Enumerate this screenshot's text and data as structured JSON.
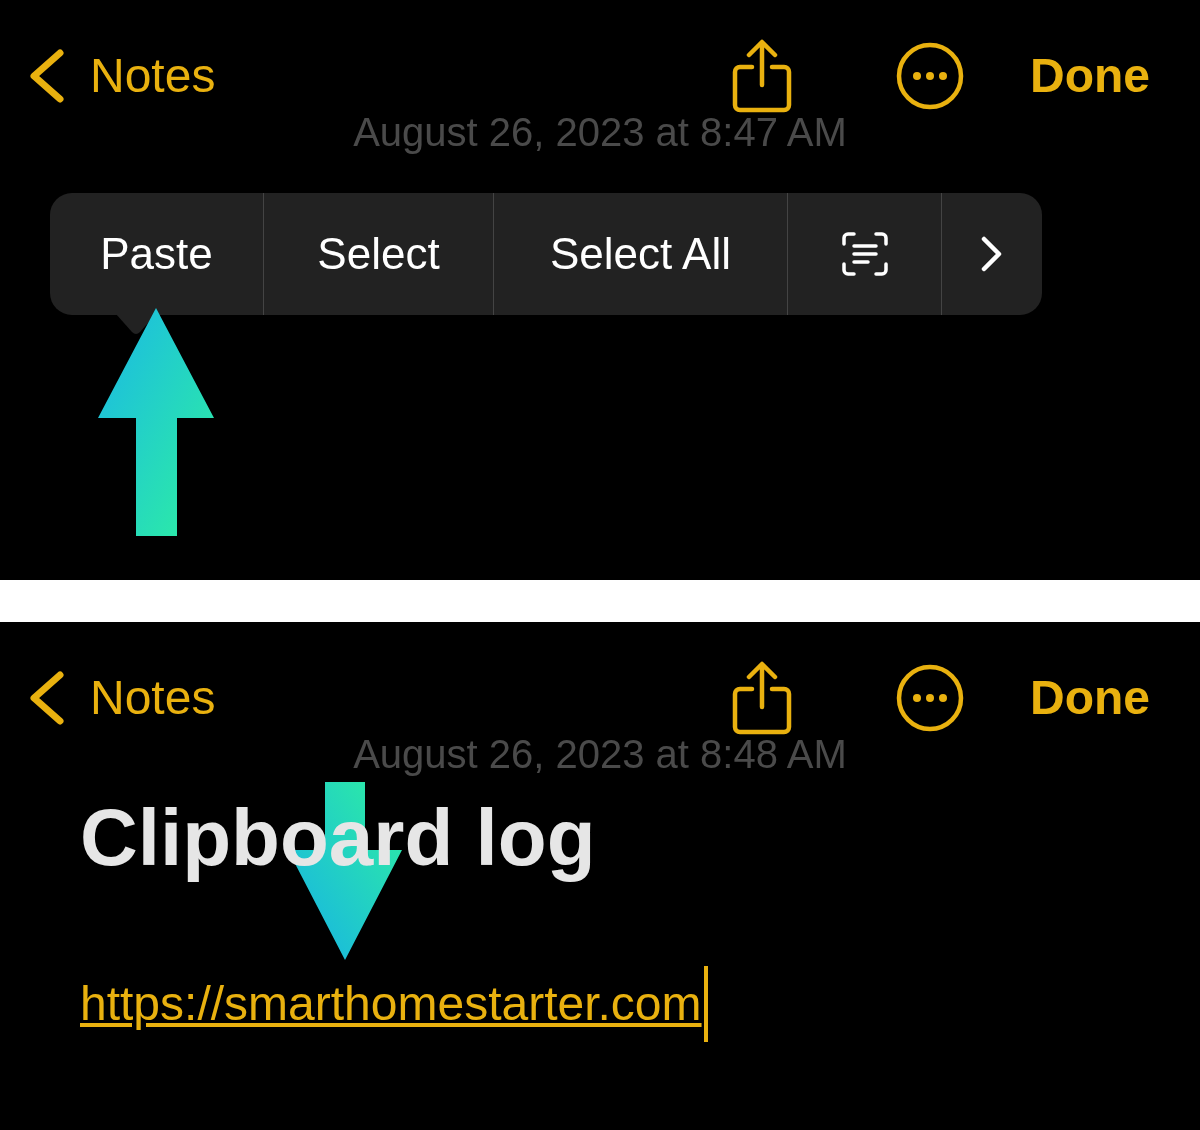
{
  "screens": [
    {
      "nav": {
        "back_label": "Notes",
        "done_label": "Done"
      },
      "date": "August 26, 2023 at 8:47 AM",
      "edit_menu": [
        {
          "kind": "text",
          "label": "Paste"
        },
        {
          "kind": "text",
          "label": "Select"
        },
        {
          "kind": "text",
          "label": "Select All"
        },
        {
          "kind": "scan"
        },
        {
          "kind": "more"
        }
      ],
      "annotation_arrow": {
        "kind": "up"
      }
    },
    {
      "nav": {
        "back_label": "Notes",
        "done_label": "Done"
      },
      "date": "August 26, 2023 at 8:48 AM",
      "title": "Clipboard log",
      "link": "https://smarthomestarter.com",
      "annotation_arrow": {
        "kind": "down"
      }
    }
  ]
}
